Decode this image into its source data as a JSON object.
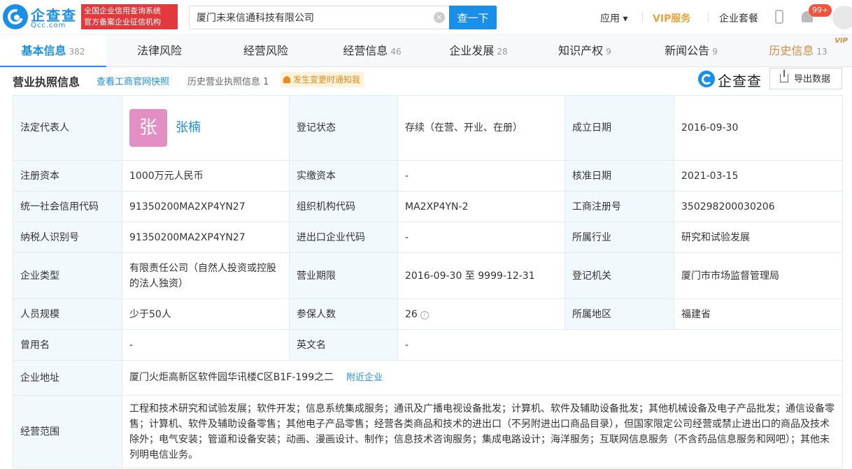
{
  "header": {
    "logo_cn": "企查查",
    "logo_en": "Qcc.com",
    "badge_line1": "全国企业信用查询系统",
    "badge_line2": "官方备案企业征信机构",
    "search_value": "厦门未来信通科技有限公司",
    "search_button": "查一下",
    "app_label": "应用 ▾",
    "vip_label": "VIP服务",
    "package_label": "企业套餐",
    "notify_count": "99+"
  },
  "tabs": [
    {
      "label": "基本信息",
      "count": "382"
    },
    {
      "label": "法律风险",
      "count": ""
    },
    {
      "label": "经营风险",
      "count": ""
    },
    {
      "label": "经营信息",
      "count": "46"
    },
    {
      "label": "企业发展",
      "count": "28"
    },
    {
      "label": "知识产权",
      "count": "9"
    },
    {
      "label": "新闻公告",
      "count": "9"
    },
    {
      "label": "历史信息",
      "count": "13",
      "tag": "VIP"
    }
  ],
  "section": {
    "title": "营业执照信息",
    "link_official": "查看工商官网快照",
    "link_history": "历史营业执照信息 1",
    "notify": "发生变更时通知我",
    "brand": "企查查",
    "export": "导出数据"
  },
  "info": {
    "legal_rep_label": "法定代表人",
    "legal_rep_avatar": "张",
    "legal_rep_name": "张楠",
    "reg_status_label": "登记状态",
    "reg_status": "存续（在营、开业、在册）",
    "found_date_label": "成立日期",
    "found_date": "2016-09-30",
    "reg_capital_label": "注册资本",
    "reg_capital": "1000万元人民币",
    "paid_capital_label": "实缴资本",
    "paid_capital": "-",
    "approve_date_label": "核准日期",
    "approve_date": "2021-03-15",
    "credit_code_label": "统一社会信用代码",
    "credit_code": "91350200MA2XP4YN27",
    "org_code_label": "组织机构代码",
    "org_code": "MA2XP4YN-2",
    "biz_reg_label": "工商注册号",
    "biz_reg": "350298200030206",
    "taxpayer_label": "纳税人识别号",
    "taxpayer": "91350200MA2XP4YN27",
    "import_export_label": "进出口企业代码",
    "import_export": "-",
    "industry_label": "所属行业",
    "industry": "研究和试验发展",
    "type_label": "企业类型",
    "type": "有限责任公司（自然人投资或控股的法人独资）",
    "term_label": "营业期限",
    "term": "2016-09-30 至 9999-12-31",
    "authority_label": "登记机关",
    "authority": "厦门市市场监督管理局",
    "staff_label": "人员规模",
    "staff": "少于50人",
    "insured_label": "参保人数",
    "insured": "26",
    "region_label": "所属地区",
    "region": "福建省",
    "former_name_label": "曾用名",
    "former_name": "-",
    "english_name_label": "英文名",
    "english_name": "-",
    "address_label": "企业地址",
    "address": "厦门火炬高新区软件园华讯楼C区B1F-199之二",
    "nearby": "附近企业",
    "scope_label": "经营范围",
    "scope": "工程和技术研究和试验发展；软件开发；信息系统集成服务；通讯及广播电视设备批发；计算机、软件及辅助设备批发；其他机械设备及电子产品批发；通信设备零售；计算机、软件及辅助设备零售；其他电子产品零售；经营各类商品和技术的进出口（不另附进出口商品目录），但国家限定公司经营或禁止进出口的商品及技术除外；电气安装；管道和设备安装；动画、漫画设计、制作；信息技术咨询服务；集成电路设计；海洋服务；互联网信息服务（不含药品信息服务和网吧）；其他未列明电信业务。"
  }
}
